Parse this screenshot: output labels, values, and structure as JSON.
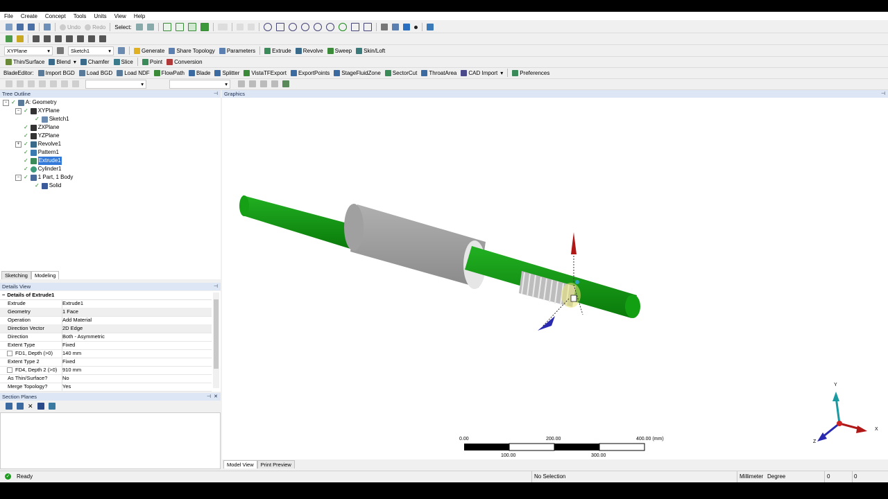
{
  "menu": [
    "File",
    "Create",
    "Concept",
    "Tools",
    "Units",
    "View",
    "Help"
  ],
  "toolbar1": {
    "undo": "Undo",
    "redo": "Redo",
    "select": "Select:"
  },
  "toolbar3": {
    "plane": "XYPlane",
    "sketch": "Sketch1",
    "generate": "Generate",
    "share_topology": "Share Topology",
    "parameters": "Parameters",
    "extrude": "Extrude",
    "revolve": "Revolve",
    "sweep": "Sweep",
    "skin_loft": "Skin/Loft"
  },
  "toolbar4": {
    "thin_surface": "Thin/Surface",
    "blend": "Blend",
    "chamfer": "Chamfer",
    "slice": "Slice",
    "point": "Point",
    "conversion": "Conversion"
  },
  "toolbar5": {
    "blade_editor": "BladeEditor:",
    "import_bgd": "Import BGD",
    "load_bgd": "Load BGD",
    "load_ndf": "Load NDF",
    "flowpath": "FlowPath",
    "blade": "Blade",
    "splitter": "Splitter",
    "vistatf": "VistaTFExport",
    "exportpoints": "ExportPoints",
    "stagefluidzone": "StageFluidZone",
    "sectorcut": "SectorCut",
    "throatarea": "ThroatArea",
    "cad_import": "CAD Import",
    "preferences": "Preferences"
  },
  "tree": {
    "title": "Tree Outline",
    "nodes": [
      {
        "label": "A: Geometry"
      },
      {
        "label": "XYPlane"
      },
      {
        "label": "Sketch1"
      },
      {
        "label": "ZXPlane"
      },
      {
        "label": "YZPlane"
      },
      {
        "label": "Revolve1"
      },
      {
        "label": "Pattern1"
      },
      {
        "label": "Extrude1"
      },
      {
        "label": "Cylinder1"
      },
      {
        "label": "1 Part, 1 Body"
      },
      {
        "label": "Solid"
      }
    ]
  },
  "mode_tabs": {
    "sketching": "Sketching",
    "modeling": "Modeling"
  },
  "details": {
    "title": "Details View",
    "group": "Details of Extrude1",
    "rows": [
      {
        "k": "Extrude",
        "v": "Extrude1"
      },
      {
        "k": "Geometry",
        "v": "1 Face"
      },
      {
        "k": "Operation",
        "v": "Add Material"
      },
      {
        "k": "Direction Vector",
        "v": "2D Edge"
      },
      {
        "k": "Direction",
        "v": "Both - Asymmetric"
      },
      {
        "k": "Extent Type",
        "v": "Fixed"
      },
      {
        "k": "FD1, Depth (>0)",
        "v": "140 mm"
      },
      {
        "k": "Extent Type 2",
        "v": "Fixed"
      },
      {
        "k": "FD4, Depth 2 (>0)",
        "v": "910 mm"
      },
      {
        "k": "As Thin/Surface?",
        "v": "No"
      },
      {
        "k": "Merge Topology?",
        "v": "Yes"
      }
    ]
  },
  "section_planes": {
    "title": "Section Planes"
  },
  "graphics": {
    "title": "Graphics",
    "scale": {
      "t0": "0.00",
      "t200": "200.00",
      "t400": "400.00 (mm)",
      "t100": "100.00",
      "t300": "300.00"
    },
    "triad": {
      "x": "X",
      "y": "Y",
      "z": "Z"
    }
  },
  "bottom_tabs": {
    "model_view": "Model View",
    "print_preview": "Print Preview"
  },
  "status": {
    "ready": "Ready",
    "selection": "No Selection",
    "units": "Millimeter",
    "angle": "Degree",
    "v1": "0",
    "v2": "0"
  },
  "colors": {
    "shaft": "#119a11",
    "hub": "#9a9a9a",
    "highlight": "#3379d9",
    "panel_head": "#dce6f4"
  }
}
